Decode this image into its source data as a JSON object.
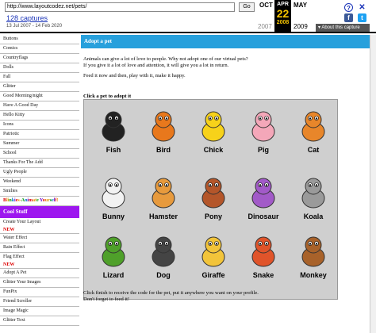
{
  "wayback": {
    "url": "http://www.layoutcodez.net/pets/",
    "go": "Go",
    "captures": "128 captures",
    "range": "13 Jul 2007 - 14 Feb 2020",
    "prev_month": "OCT",
    "cur_month": "APR",
    "next_month": "MAY",
    "day": "22",
    "prev_year": "2007",
    "cur_year": "2008",
    "next_year": "2009",
    "about": "▾ About this capture",
    "icons": [
      "help-icon",
      "close-icon",
      "facebook-icon",
      "twitter-icon"
    ]
  },
  "sidebar": {
    "items_top": [
      "Buttons",
      "Comics",
      "Countryflags",
      "Dolls",
      "Fall",
      "Glitter",
      "Good Morning/night",
      "Have A Good Day",
      "Hello Kitty",
      "Icons",
      "Patriotic",
      "Summer",
      "School",
      "Thanks For The Add",
      "Ugly People",
      "Weekend",
      "Smilies"
    ],
    "blinkies": "Blinkies-Animate Yourself!",
    "section": "Cool Stuff",
    "items_bottom": [
      {
        "label": "Create Your Layout",
        "new": true
      },
      {
        "label": "Water Effect",
        "new": false
      },
      {
        "label": "Rain Effect",
        "new": false
      },
      {
        "label": "Flag Effect",
        "new": true
      },
      {
        "label": "Adopt A Pet",
        "new": false
      },
      {
        "label": "Glitter Your Images",
        "new": false
      },
      {
        "label": "FunPix",
        "new": false
      },
      {
        "label": "Friend Scroller",
        "new": false
      },
      {
        "label": "Image Magic",
        "new": false
      },
      {
        "label": "Glitter Text",
        "new": false
      }
    ],
    "new_label": "NEW"
  },
  "main": {
    "heading": "Adopt a pet",
    "intro1": "Animals can give a lot of love to people. Why not adopt one of our virtual pets?",
    "intro2": "If you give it a lot of love and attention, it will give you a lot in return.",
    "intro3": "Feed it now and then, play with it, make it happy.",
    "instruction": "Click a pet to adopt it",
    "footer1": "Click finish to receive the code for the pet, put it anywhere you want on your profile.",
    "footer2": "Don't forget to feed it!"
  },
  "pets": [
    {
      "name": "Fish",
      "color": "#222222"
    },
    {
      "name": "Bird",
      "color": "#e8781c"
    },
    {
      "name": "Chick",
      "color": "#f7d21a"
    },
    {
      "name": "Pig",
      "color": "#f4a7b9"
    },
    {
      "name": "Cat",
      "color": "#e8862a"
    },
    {
      "name": "Bunny",
      "color": "#f2f2f2"
    },
    {
      "name": "Hamster",
      "color": "#e79a3d"
    },
    {
      "name": "Pony",
      "color": "#b4562a"
    },
    {
      "name": "Dinosaur",
      "color": "#a25ac8"
    },
    {
      "name": "Koala",
      "color": "#9a9a9a"
    },
    {
      "name": "Lizard",
      "color": "#4fa02a"
    },
    {
      "name": "Dog",
      "color": "#444444"
    },
    {
      "name": "Giraffe",
      "color": "#f2c43a"
    },
    {
      "name": "Snake",
      "color": "#e0542a"
    },
    {
      "name": "Monkey",
      "color": "#a8622a"
    }
  ]
}
